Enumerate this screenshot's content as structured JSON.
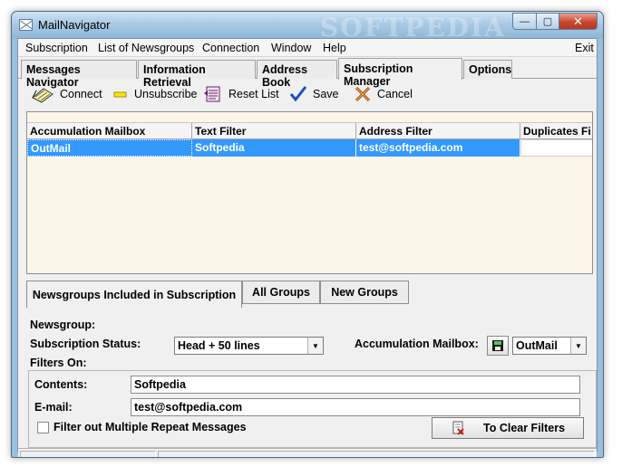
{
  "window": {
    "title": "MailNavigator",
    "watermark": "SOFTPEDIA",
    "controls": {
      "minimize": "—",
      "maximize": "▢",
      "close": "✕"
    }
  },
  "menu": {
    "items": [
      "Subscription",
      "List of Newsgroups",
      "Connection",
      "Window",
      "Help"
    ],
    "exit": "Exit"
  },
  "tabs": {
    "items": [
      "Messages Navigator",
      "Information Retrieval",
      "Address Book",
      "Subscription Manager",
      "Options"
    ],
    "active_index": 3
  },
  "toolbar": {
    "connect": "Connect",
    "unsubscribe": "Unsubscribe",
    "reset_list": "Reset List",
    "save": "Save",
    "cancel": "Cancel"
  },
  "grid": {
    "columns": [
      "Accumulation Mailbox",
      "Text Filter",
      "Address Filter",
      "Duplicates Fi"
    ],
    "rows": [
      [
        "OutMail",
        "Softpedia",
        "test@softpedia.com",
        ""
      ]
    ],
    "selected_row": 0,
    "selection_color": "#3399ff"
  },
  "lower_tabs": {
    "items": [
      "Newsgroups Included in Subscription",
      "All Groups",
      "New Groups"
    ],
    "active_index": 0
  },
  "form": {
    "newsgroup_label": "Newsgroup:",
    "subscription_status_label": "Subscription Status:",
    "subscription_status_value": "Head + 50 lines",
    "accumulation_mailbox_label": "Accumulation Mailbox:",
    "accumulation_mailbox_value": "OutMail",
    "filters_on_label": "Filters On:",
    "contents_label": "Contents:",
    "contents_value": "Softpedia",
    "email_label": "E-mail:",
    "email_value": "test@softpedia.com",
    "filter_repeat_label": "Filter out Multiple Repeat Messages",
    "filter_repeat_checked": false,
    "clear_filters_label": "To Clear Filters"
  }
}
